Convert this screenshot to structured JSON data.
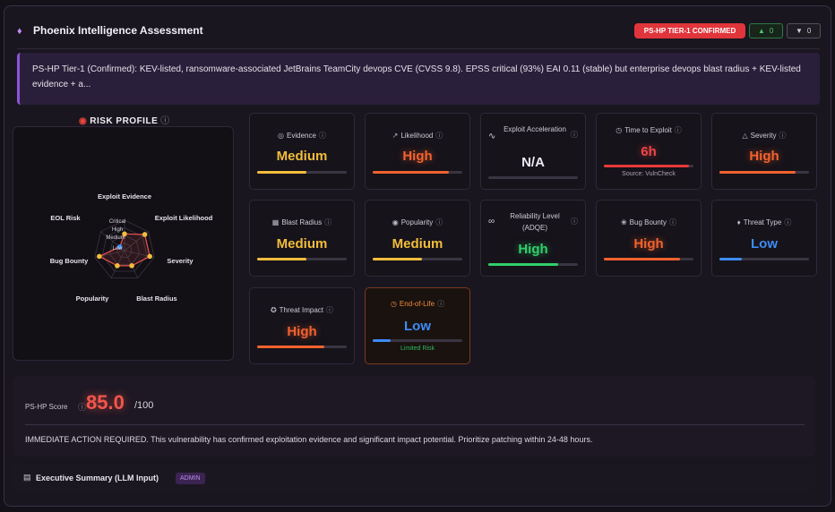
{
  "header": {
    "title": "Phoenix Intelligence Assessment",
    "badge": "PS-HP TIER-1 CONFIRMED",
    "upvotes": "0",
    "downvotes": "0"
  },
  "summary": "PS-HP Tier-1 (Confirmed): KEV-listed, ransomware-associated JetBrains TeamCity devops CVE (CVSS 9.8). EPSS critical (93%) EAI 0.11 (stable) but enterprise devops blast radius + KEV-listed evidence + a...",
  "risk_profile": {
    "title": "RISK PROFILE",
    "axes": [
      "Exploit Evidence",
      "Exploit Likelihood",
      "Severity",
      "Blast Radius",
      "Popularity",
      "Bug Bounty",
      "EOL Risk"
    ],
    "levels": [
      "Critical",
      "High",
      "Medium",
      "Low"
    ]
  },
  "cards": {
    "evidence": {
      "label": "Evidence",
      "value": "Medium",
      "level": 0.55
    },
    "likelihood": {
      "label": "Likelihood",
      "value": "High",
      "level": 0.85
    },
    "exploit_accel": {
      "label": "Exploit Acceleration",
      "value": "N/A",
      "level": 0
    },
    "tte": {
      "label": "Time to Exploit",
      "value": "6h",
      "level": 0.95,
      "note": "Source: VulnCheck"
    },
    "severity": {
      "label": "Severity",
      "value": "High",
      "level": 0.85
    },
    "blast": {
      "label": "Blast Radius",
      "value": "Medium",
      "level": 0.55
    },
    "popularity": {
      "label": "Popularity",
      "value": "Medium",
      "level": 0.55
    },
    "reliability": {
      "label": "Reliability Level (ADQE)",
      "value": "High",
      "level": 0.78
    },
    "bounty": {
      "label": "Bug Bounty",
      "value": "High",
      "level": 0.85
    },
    "threat_type": {
      "label": "Threat Type",
      "value": "Low",
      "level": 0.25
    },
    "threat_impact": {
      "label": "Threat Impact",
      "value": "High",
      "level": 0.75
    },
    "eol": {
      "label": "End-of-Life",
      "value": "Low",
      "level": 0.2,
      "note": "Limited Risk"
    }
  },
  "score": {
    "label": "PS-HP Score",
    "value": "85.0",
    "outof": "/100",
    "action": "IMMEDIATE ACTION REQUIRED. This vulnerability has confirmed exploitation evidence and significant impact potential. Prioritize patching within 24-48 hours."
  },
  "exec_summary": {
    "title": "Executive Summary (LLM Input)",
    "badge": "ADMIN"
  },
  "colors": {
    "medium": "#f2bd3c",
    "high": "#f2622e",
    "low": "#3d8cf5",
    "good": "#2fd06a",
    "accent": "#8b55d8"
  }
}
